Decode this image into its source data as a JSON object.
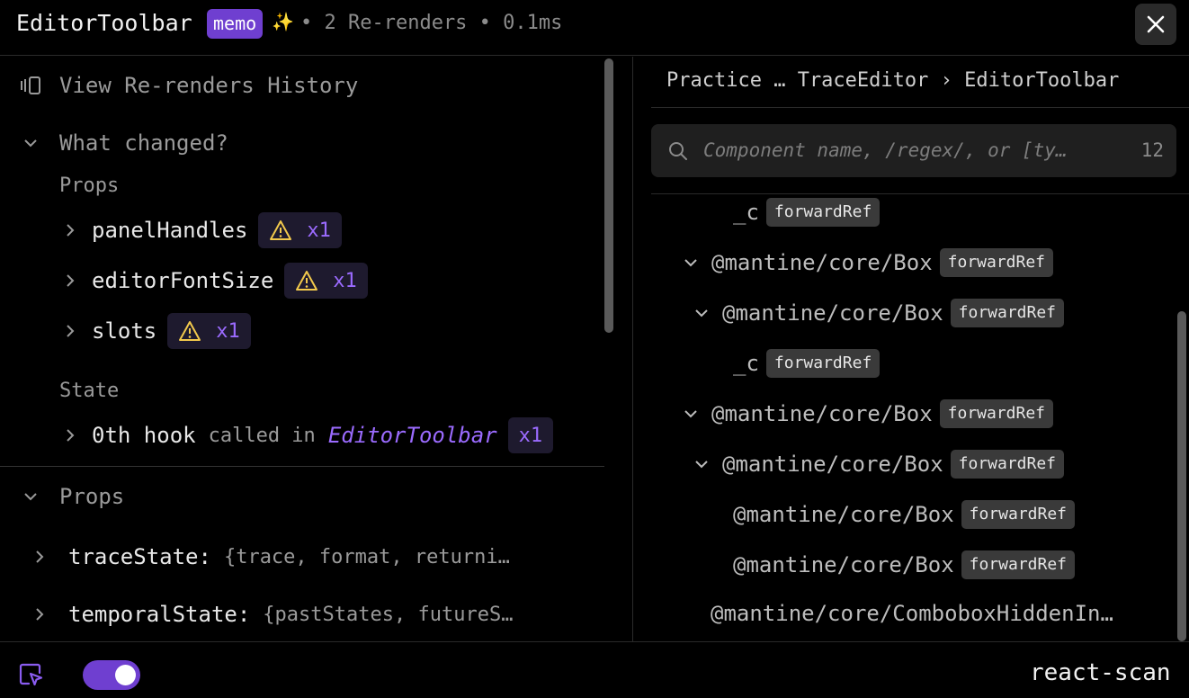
{
  "header": {
    "component_name": "EditorToolbar",
    "memo_badge": "memo",
    "sparkle": "✨",
    "stats": "• 2 Re-renders • 0.1ms",
    "close_icon": "close-icon"
  },
  "left": {
    "history_label": "View Re-renders History",
    "what_changed": "What changed?",
    "changed_props_heading": "Props",
    "changed_props": [
      {
        "name": "panelHandles",
        "count": "x1"
      },
      {
        "name": "editorFontSize",
        "count": "x1"
      },
      {
        "name": "slots",
        "count": "x1"
      }
    ],
    "state_heading": "State",
    "state_hook": {
      "name": "0th hook",
      "called_in": "called in",
      "component": "EditorToolbar",
      "count": "x1"
    },
    "props_section": "Props",
    "props": [
      {
        "key": "traceState:",
        "value": "{trace, format, returni…"
      },
      {
        "key": "temporalState:",
        "value": "{pastStates, futureS…"
      }
    ]
  },
  "right": {
    "breadcrumb": "Practice … TraceEditor › EditorToolbar",
    "search_placeholder": "Component name, /regex/, or [ty…",
    "search_count": "12",
    "tree": [
      {
        "name": "_c",
        "badge": "forwardRef"
      },
      {
        "name": "@mantine/core/Box",
        "badge": "forwardRef"
      },
      {
        "name": "@mantine/core/Box",
        "badge": "forwardRef"
      },
      {
        "name": "_c",
        "badge": "forwardRef"
      },
      {
        "name": "@mantine/core/Box",
        "badge": "forwardRef"
      },
      {
        "name": "@mantine/core/Box",
        "badge": "forwardRef"
      },
      {
        "name": "@mantine/core/Box",
        "badge": "forwardRef"
      },
      {
        "name": "@mantine/core/Box",
        "badge": "forwardRef"
      },
      {
        "name": "@mantine/core/ComboboxHiddenIn…",
        "badge": ""
      }
    ]
  },
  "footer": {
    "brand": "react-scan",
    "inspect_icon": "cursor-select-icon",
    "toggle_on": true
  },
  "colors": {
    "accent": "#6f3fd0",
    "accent_text": "#9b6bff",
    "warning": "#f2c94c",
    "background": "#000000"
  }
}
